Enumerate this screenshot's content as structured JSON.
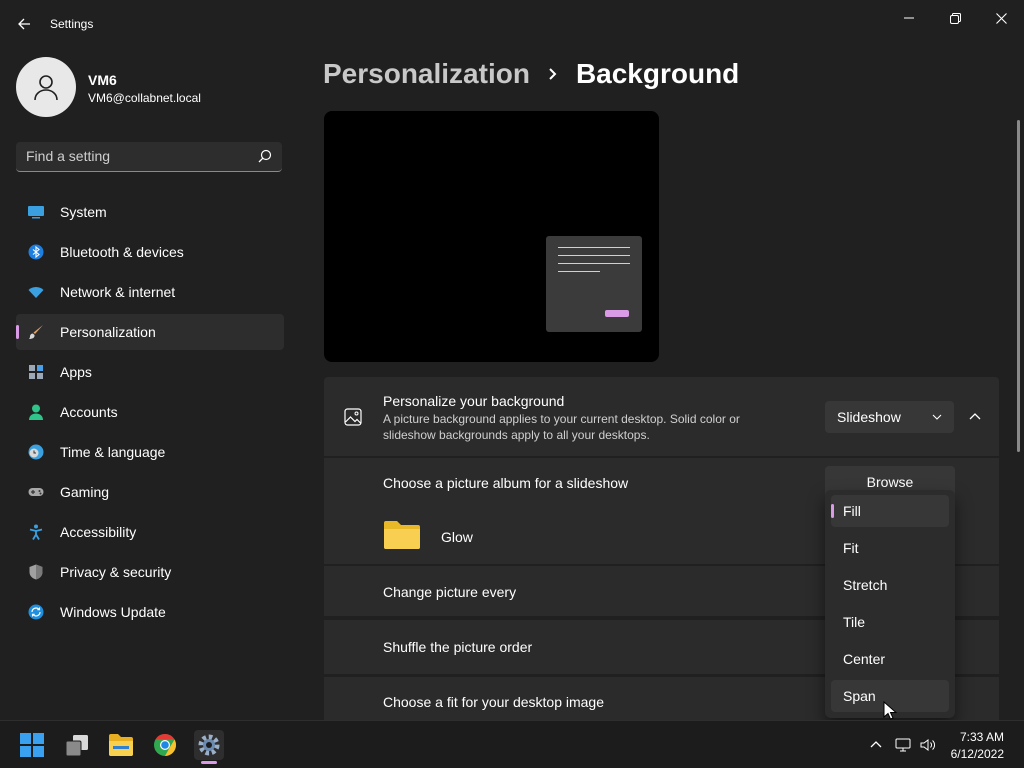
{
  "window": {
    "title": "Settings"
  },
  "profile": {
    "name": "VM6",
    "email": "VM6@collabnet.local"
  },
  "search": {
    "placeholder": "Find a setting"
  },
  "sidebar": {
    "items": [
      {
        "label": "System",
        "icon": "system-icon"
      },
      {
        "label": "Bluetooth & devices",
        "icon": "bluetooth-icon"
      },
      {
        "label": "Network & internet",
        "icon": "wifi-icon"
      },
      {
        "label": "Personalization",
        "icon": "brush-icon",
        "active": true
      },
      {
        "label": "Apps",
        "icon": "apps-icon"
      },
      {
        "label": "Accounts",
        "icon": "person-icon"
      },
      {
        "label": "Time & language",
        "icon": "clock-globe-icon"
      },
      {
        "label": "Gaming",
        "icon": "gamepad-icon"
      },
      {
        "label": "Accessibility",
        "icon": "accessibility-icon"
      },
      {
        "label": "Privacy & security",
        "icon": "shield-icon"
      },
      {
        "label": "Windows Update",
        "icon": "update-icon"
      }
    ]
  },
  "breadcrumb": {
    "parent": "Personalization",
    "current": "Background"
  },
  "background": {
    "title": "Personalize your background",
    "desc": "A picture background applies to your current desktop. Solid color or slideshow backgrounds apply to all your desktops.",
    "type_value": "Slideshow"
  },
  "slideshow": {
    "album_label": "Choose a picture album for a slideshow",
    "browse_label": "Browse",
    "album_name": "Glow",
    "interval_label": "Change picture every",
    "shuffle_label": "Shuffle the picture order",
    "fit_label": "Choose a fit for your desktop image"
  },
  "fit_menu": {
    "options": [
      "Fill",
      "Fit",
      "Stretch",
      "Tile",
      "Center",
      "Span"
    ],
    "selected": "Fill",
    "hovered": "Span"
  },
  "taskbar": {
    "apps": [
      "start-icon",
      "task-view-icon",
      "file-explorer-icon",
      "chrome-icon",
      "settings-icon"
    ],
    "time": "7:33 AM",
    "date": "6/12/2022"
  },
  "colors": {
    "accent": "#d99ae6",
    "background": "#202020",
    "card": "#2b2b2b"
  }
}
